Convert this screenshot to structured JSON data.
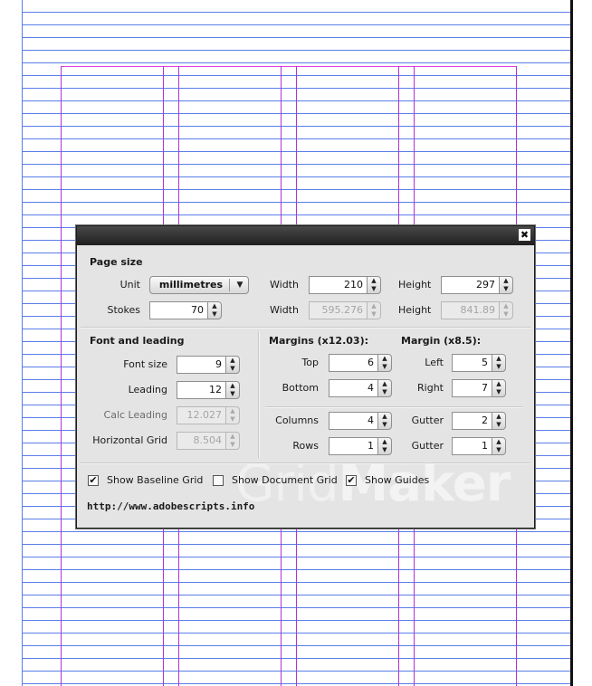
{
  "dialog": {
    "close_glyph": "✖",
    "watermark": {
      "part1": "Grid",
      "part2": "Maker"
    },
    "page_size": {
      "heading": "Page size",
      "unit_label": "Unit",
      "unit_value": "millimetres",
      "width_label": "Width",
      "width_value": "210",
      "height_label": "Height",
      "height_value": "297",
      "stokes_label": "Stokes",
      "stokes_value": "70",
      "width_pt_label": "Width",
      "width_pt_value": "595.276",
      "height_pt_label": "Height",
      "height_pt_value": "841.89"
    },
    "font_leading": {
      "heading": "Font and leading",
      "font_size_label": "Font size",
      "font_size_value": "9",
      "leading_label": "Leading",
      "leading_value": "12",
      "calc_leading_label": "Calc Leading",
      "calc_leading_value": "12.027",
      "horizontal_grid_label": "Horizontal Grid",
      "horizontal_grid_value": "8.504"
    },
    "margins": {
      "heading": "Margins (x12.03):",
      "top_label": "Top",
      "top_value": "6",
      "bottom_label": "Bottom",
      "bottom_value": "4"
    },
    "margin_x": {
      "heading": "Margin (x8.5):",
      "left_label": "Left",
      "left_value": "5",
      "right_label": "Right",
      "right_value": "7"
    },
    "grid": {
      "columns_label": "Columns",
      "columns_value": "4",
      "col_gutter_label": "Gutter",
      "col_gutter_value": "2",
      "rows_label": "Rows",
      "rows_value": "1",
      "row_gutter_label": "Gutter",
      "row_gutter_value": "1"
    },
    "options": {
      "show_baseline_grid": {
        "label": "Show Baseline Grid",
        "checked": true,
        "glyph": "✔"
      },
      "show_document_grid": {
        "label": "Show Document Grid",
        "checked": false,
        "glyph": ""
      },
      "show_guides": {
        "label": "Show Guides",
        "checked": true,
        "glyph": "✔"
      }
    },
    "link": "http://www.adobescripts.info"
  },
  "icons": {
    "up": "▲",
    "down": "▼",
    "dropdown": "▼"
  },
  "colors": {
    "baseline_grid": "#5a7ee8",
    "column_guide": "#b033d8",
    "margin_guide": "#e040e0",
    "dialog_bg": "#e4e4e4",
    "titlebar": "#2a2a2a"
  }
}
